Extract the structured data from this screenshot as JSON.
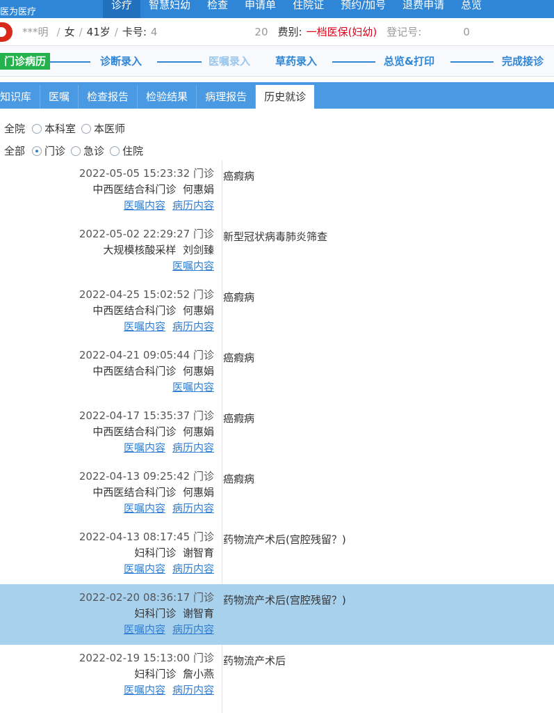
{
  "topbar": {
    "brand": "医为医疗",
    "menu": [
      "诊疗",
      "智慧妇幼",
      "检查",
      "申请单",
      "住院证",
      "预约/加号",
      "退费申请",
      "总览"
    ]
  },
  "patient": {
    "name": "***明",
    "sex": "女",
    "age": "41岁",
    "card_label": "卡号:",
    "card_value": "4",
    "card_tail": "20",
    "fee_label": "费别:",
    "fee_value": "一档医保(妇幼)",
    "reg_label": "登记号:",
    "reg_value": "0"
  },
  "steps": {
    "current": "门诊病历",
    "items": [
      "诊断录入",
      "医嘱录入",
      "草药录入",
      "总览&打印",
      "完成接诊"
    ]
  },
  "tabs": [
    "知识库",
    "医嘱",
    "检查报告",
    "检验结果",
    "病理报告",
    "历史就诊"
  ],
  "active_tab": "历史就诊",
  "filters": {
    "scope": {
      "options": [
        "全院",
        "本科室",
        "本医师"
      ],
      "selected": "全院"
    },
    "type": {
      "options": [
        "全部",
        "门诊",
        "急诊",
        "住院"
      ],
      "selected": "门诊"
    }
  },
  "links": {
    "orders": "医嘱内容",
    "records": "病历内容"
  },
  "visits": [
    {
      "datetime": "2022-05-05  15:23:32",
      "type": "门诊",
      "dept": "中西医结合科门诊",
      "doctor": "何惠娟",
      "diagnosis": "癌瘕病",
      "has_record": true,
      "selected": false
    },
    {
      "datetime": "2022-05-02  22:29:27",
      "type": "门诊",
      "dept": "大规模核酸采样",
      "doctor": "刘剑臻",
      "diagnosis": "新型冠状病毒肺炎筛查",
      "has_record": false,
      "selected": false
    },
    {
      "datetime": "2022-04-25  15:02:52",
      "type": "门诊",
      "dept": "中西医结合科门诊",
      "doctor": "何惠娟",
      "diagnosis": "癌瘕病",
      "has_record": true,
      "selected": false
    },
    {
      "datetime": "2022-04-21  09:05:44",
      "type": "门诊",
      "dept": "中西医结合科门诊",
      "doctor": "何惠娟",
      "diagnosis": "癌瘕病",
      "has_record": false,
      "selected": false
    },
    {
      "datetime": "2022-04-17  15:35:37",
      "type": "门诊",
      "dept": "中西医结合科门诊",
      "doctor": "何惠娟",
      "diagnosis": "癌瘕病",
      "has_record": true,
      "selected": false
    },
    {
      "datetime": "2022-04-13  09:25:42",
      "type": "门诊",
      "dept": "中西医结合科门诊",
      "doctor": "何惠娟",
      "diagnosis": "癌瘕病",
      "has_record": true,
      "selected": false
    },
    {
      "datetime": "2022-04-13  08:17:45",
      "type": "门诊",
      "dept": "妇科门诊",
      "doctor": "谢智育",
      "diagnosis": "药物流产术后(宫腔残留？)",
      "has_record": true,
      "selected": false
    },
    {
      "datetime": "2022-02-20  08:36:17",
      "type": "门诊",
      "dept": "妇科门诊",
      "doctor": "谢智育",
      "diagnosis": "药物流产术后(宫腔残留？)",
      "has_record": true,
      "selected": true
    },
    {
      "datetime": "2022-02-19  15:13:00",
      "type": "门诊",
      "dept": "妇科门诊",
      "doctor": "詹小燕",
      "diagnosis": "药物流产术后",
      "has_record": true,
      "selected": false
    }
  ],
  "colors": {
    "primary": "#2f86d6",
    "tab_bar": "#4a9ae3",
    "selected_row": "#a8d1ee",
    "current_step": "#23b24b",
    "fee_red": "#e0001a",
    "link": "#2f7ed1"
  }
}
